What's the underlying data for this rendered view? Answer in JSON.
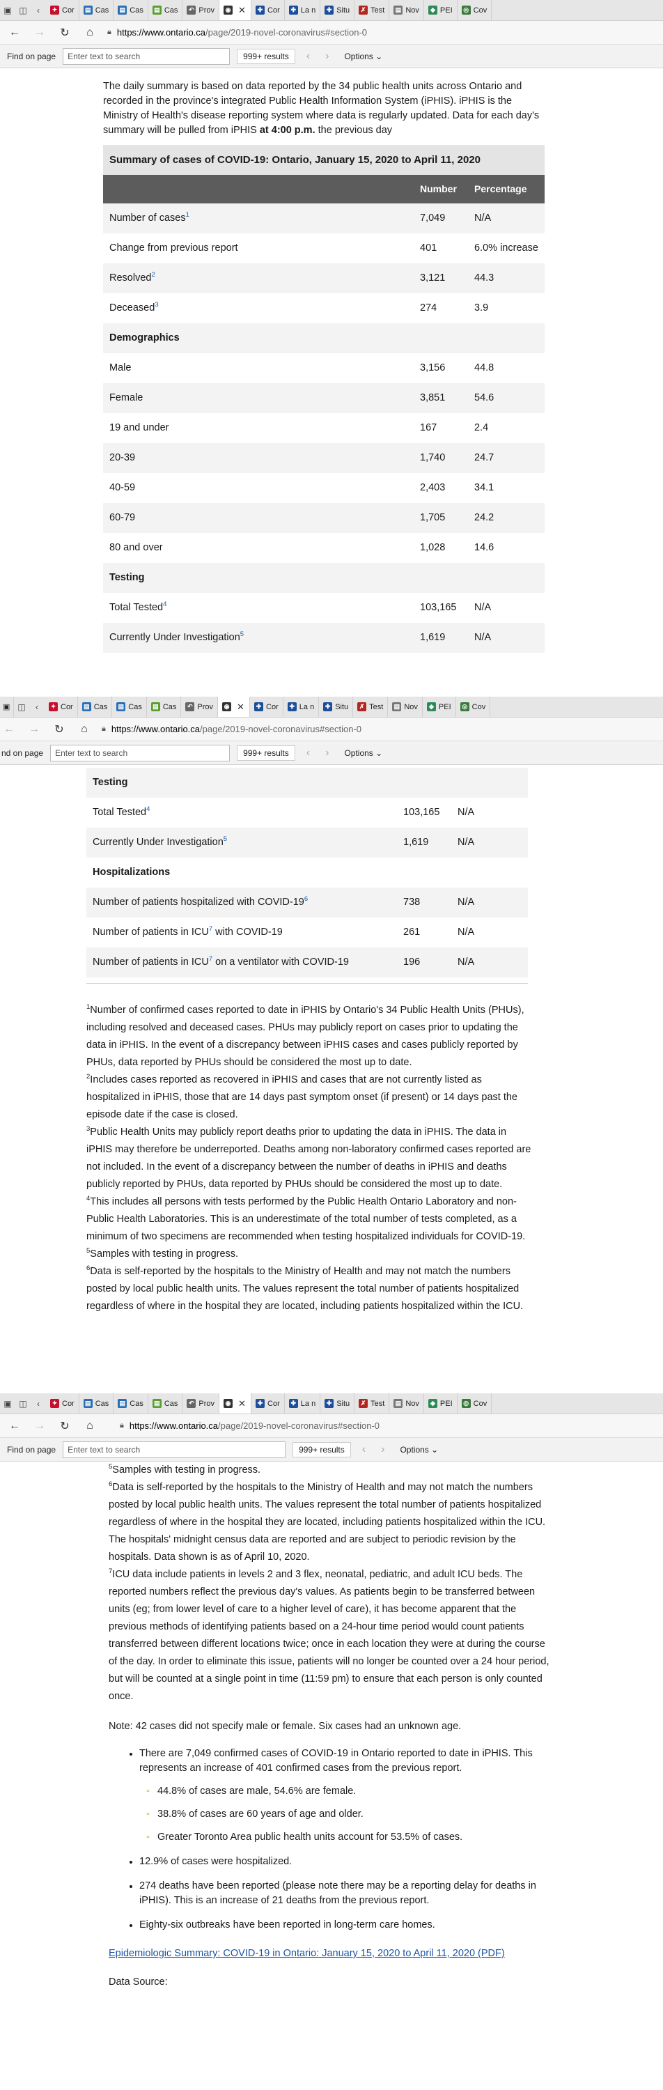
{
  "browser": {
    "tabs": [
      "Cor",
      "Cas",
      "Cas",
      "Cas",
      "Prov",
      "",
      "Cor",
      "La n",
      "Situ",
      "Test",
      "Nov",
      "PEI",
      "Cov"
    ],
    "url_host": "https://www.ontario.ca",
    "url_path": "/page/2019-novel-coronavirus#section-0",
    "find_label": "Find on page",
    "find_label_cropped": "nd on page",
    "find_placeholder": "Enter text to search",
    "results": "999+ results",
    "options": "Options",
    "colors": {
      "tab_bar": "#e6e6e6",
      "active_tab": "#ffffff"
    }
  },
  "seg1": {
    "intro": "The daily summary is based on data reported by the 34 public health units across Ontario and recorded in the province's integrated Public Health Information System (iPHIS). iPHIS is the Ministry of Health's disease reporting system where data is regularly updated. Data for each day's summary will be pulled from iPHIS ",
    "intro_bold": "at 4:00 p.m.",
    "intro_end": " the previous day",
    "table_caption": "Summary of cases of COVID-19: Ontario, January 15, 2020 to April 11, 2020",
    "col_number": "Number",
    "col_percentage": "Percentage",
    "rows": [
      {
        "label": "Number of cases",
        "sup": "1",
        "number": "7,049",
        "pct": "N/A"
      },
      {
        "label": "Change from previous report",
        "sup": "",
        "number": "401",
        "pct": "6.0% increase"
      },
      {
        "label": "Resolved",
        "sup": "2",
        "number": "3,121",
        "pct": "44.3"
      },
      {
        "label": "Deceased",
        "sup": "3",
        "number": "274",
        "pct": "3.9"
      },
      {
        "label": "Demographics",
        "section": true
      },
      {
        "label": "Male",
        "sup": "",
        "number": "3,156",
        "pct": "44.8"
      },
      {
        "label": "Female",
        "sup": "",
        "number": "3,851",
        "pct": "54.6"
      },
      {
        "label": "19 and under",
        "sup": "",
        "number": "167",
        "pct": "2.4"
      },
      {
        "label": "20-39",
        "sup": "",
        "number": "1,740",
        "pct": "24.7"
      },
      {
        "label": "40-59",
        "sup": "",
        "number": "2,403",
        "pct": "34.1"
      },
      {
        "label": "60-79",
        "sup": "",
        "number": "1,705",
        "pct": "24.2"
      },
      {
        "label": "80 and over",
        "sup": "",
        "number": "1,028",
        "pct": "14.6"
      },
      {
        "label": "Testing",
        "section": true
      },
      {
        "label": "Total Tested",
        "sup": "4",
        "number": "103,165",
        "pct": "N/A"
      },
      {
        "label": "Currently Under Investigation",
        "sup": "5",
        "number": "1,619",
        "pct": "N/A"
      }
    ]
  },
  "seg2": {
    "rows": [
      {
        "label": "Testing",
        "section": true
      },
      {
        "label": "Total Tested",
        "sup": "4",
        "number": "103,165",
        "pct": "N/A"
      },
      {
        "label": "Currently Under Investigation",
        "sup": "5",
        "number": "1,619",
        "pct": "N/A"
      },
      {
        "label": "Hospitalizations",
        "section": true
      },
      {
        "label": "Number of patients hospitalized with COVID-19",
        "sup": "6",
        "number": "738",
        "pct": "N/A"
      },
      {
        "label": "Number of patients in ICU",
        "sup": "7",
        "label_after": " with COVID-19",
        "number": "261",
        "pct": "N/A"
      },
      {
        "label": "Number of patients in ICU",
        "sup": "7",
        "label_after": " on a ventilator with COVID-19",
        "number": "196",
        "pct": "N/A"
      }
    ],
    "footnotes": [
      {
        "n": "1",
        "text": "Number of confirmed cases reported to date in iPHIS by Ontario's 34 Public Health Units (PHUs), including resolved and deceased cases.  PHUs may publicly report on cases prior to updating the data in iPHIS.  In the event of a discrepancy between iPHIS cases and cases publicly reported by PHUs, data reported by PHUs should be considered the most up to date."
      },
      {
        "n": "2",
        "text": "Includes cases reported as recovered in iPHIS and cases that are not currently listed as hospitalized in iPHIS, those that are 14 days past symptom onset (if present) or 14 days past the episode date if the case is closed."
      },
      {
        "n": "3",
        "text": "Public Health Units may publicly report deaths prior to updating the data in iPHIS. The data in iPHIS may therefore be underreported. Deaths among non-laboratory confirmed cases reported are not included. In the event of a discrepancy between the number of deaths in iPHIS and deaths publicly reported by PHUs, data reported by PHUs should be considered the most up to date."
      },
      {
        "n": "4",
        "text": "This includes all persons with tests performed by the Public Health Ontario Laboratory  and non-Public Health Laboratories.  This is an underestimate of the total number of tests completed, as a minimum of two specimens are recommended when testing hospitalized individuals for COVID-19."
      },
      {
        "n": "5",
        "text": "Samples with testing in progress."
      },
      {
        "n": "6",
        "text": "Data is self-reported by the hospitals to the Ministry of Health and may not match the numbers posted by local public health units. The values represent the total number of patients hospitalized regardless of where in the hospital they are located, including patients hospitalized within the ICU."
      }
    ]
  },
  "seg3": {
    "footnotes": [
      {
        "n": "5",
        "text": "Samples with testing in progress."
      },
      {
        "n": "6",
        "text": "Data is self-reported by the hospitals to the Ministry of Health and may not match the numbers posted by local public health units. The values represent the total number of patients hospitalized regardless of where in the hospital they are located, including patients hospitalized within the ICU. The hospitals' midnight census data are reported and are subject to periodic revision by the hospitals. Data shown is as of April 10, 2020."
      },
      {
        "n": "7",
        "text": "ICU data include patients in levels 2 and 3  flex, neonatal, pediatric, and adult ICU beds. The reported numbers reflect the previous day's values. As patients begin to be transferred between units (eg; from lower level of care to a higher level of care), it has become apparent that the previous methods of identifying patients based on a 24-hour time period would count patients transferred between different locations twice; once in each location they were at during the course of the day. In order to eliminate this issue, patients will no longer be counted over a 24 hour period, but will be counted at a single point in time (11:59 pm) to ensure that each person is only counted once."
      }
    ],
    "note": "Note: 42 cases did not specify male or female. Six cases had an unknown age.",
    "bullet1": "There are 7,049 confirmed cases of COVID-19 in Ontario reported to date in iPHIS. This represents an increase of 401 confirmed cases from the previous report.",
    "sub_bullets": [
      "44.8% of cases are male, 54.6% are female.",
      "38.8% of cases are 60 years of age and older.",
      "Greater Toronto Area public health units account for 53.5% of cases."
    ],
    "bullet2": "12.9% of cases were hospitalized.",
    "bullet3": "274 deaths have been reported (please note there may be a reporting delay for deaths in iPHIS). This is an increase of 21 deaths from the previous report.",
    "bullet4": "Eighty-six outbreaks have been reported in long-term care homes.",
    "pdf_link": "Epidemiologic Summary: COVID-19 in Ontario: January 15, 2020 to April 11, 2020 (PDF)",
    "data_source": "Data Source:"
  }
}
